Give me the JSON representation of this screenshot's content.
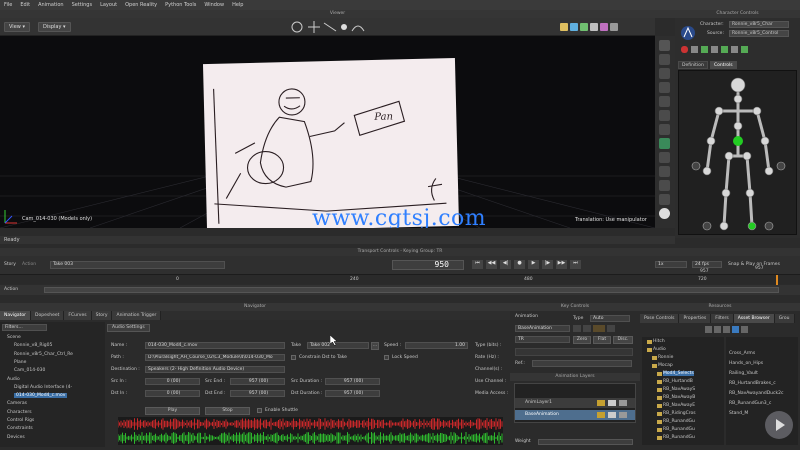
{
  "menu": [
    "File",
    "Edit",
    "Animation",
    "Settings",
    "Layout",
    "Open Reality",
    "Python Tools",
    "Window",
    "Help"
  ],
  "viewer": {
    "title": "Viewer",
    "view_btn": "View",
    "display_btn": "Display",
    "camera_label": "Cam_014-030 (Models only)",
    "translation_label": "Translation: Use manipulator",
    "axis_label": "T (Gbl)",
    "watermark": "www.cgtsj.com",
    "sketch_text": "Pan"
  },
  "status": {
    "ready": "Ready"
  },
  "character_controls": {
    "title": "Character Controls",
    "character_label": "Character:",
    "character_value": "Ronnie_v8r5_Char",
    "source_label": "Source:",
    "source_value": "Ronnie_v8r5_Control",
    "tabs": [
      "Definition",
      "Controls"
    ]
  },
  "transport": {
    "title": "Transport Controls  -  Keying Group: TR",
    "story_label": "Story",
    "action_label": "Action",
    "take_value": "Take 003",
    "frame_value": "950",
    "speed": "1x",
    "fps": "24 fps",
    "snap": "Snap & Play on Frames",
    "end_a": "957",
    "end_b": "957",
    "ruler_ticks": [
      "0",
      "240",
      "480",
      "720"
    ],
    "action_row_label": "Action"
  },
  "navigator": {
    "title": "Navigator",
    "tabs": [
      "Navigator",
      "Dopesheet",
      "FCurves",
      "Story",
      "Animation Trigger"
    ],
    "filters_label": "Filters...",
    "tree": [
      {
        "label": "Scene",
        "indent": 1
      },
      {
        "label": "Ronnie_v8_Rig05",
        "indent": 2
      },
      {
        "label": "Ronnie_v8r5_Char_Ctrl_Re",
        "indent": 2
      },
      {
        "label": "Plane",
        "indent": 2
      },
      {
        "label": "Cam_014-030",
        "indent": 2
      },
      {
        "label": "Audio",
        "indent": 1
      },
      {
        "label": "Digital Audio Interface (4-",
        "indent": 2
      },
      {
        "label": "014-030_Mod4_c.mov",
        "indent": 2,
        "selected": true
      },
      {
        "label": "Cameras",
        "indent": 1
      },
      {
        "label": "Characters",
        "indent": 1
      },
      {
        "label": "Control Rigs",
        "indent": 1
      },
      {
        "label": "Constraints",
        "indent": 1
      },
      {
        "label": "Devices",
        "indent": 1
      }
    ]
  },
  "audio_settings": {
    "tab": "Audio Settings",
    "name_label": "Name :",
    "name_value": "014-030_Mod4_c.mov",
    "take_label": "Take",
    "take_value": "Take 002",
    "speed_label": "Speed :",
    "speed_value": "1.00",
    "type_label": "Type (bits) :",
    "path_label": "Path :",
    "path_value": "D:\\Pluralsight_AH_Course_02\\C3_Module\\4\\014-030_Mo",
    "constrain_label": "Constrain Dst to Take",
    "lock_speed_label": "Lock Speed",
    "rate_label": "Rate (Hz) :",
    "destination_label": "Destination :",
    "destination_value": "Speakers (2- High Definition Audio Device)",
    "channels_label": "Channel(s) :",
    "src_in_label": "Src In :",
    "src_in_value": "0 (00)",
    "src_end_label": "Src End :",
    "src_end_value": "957 (00)",
    "src_dur_label": "Src Duration :",
    "src_dur_value": "957 (00)",
    "use_channel_label": "Use Channel :",
    "dst_in_label": "Dst In :",
    "dst_in_value": "0 (00)",
    "dst_end_label": "Dst End :",
    "dst_end_value": "957 (00)",
    "dst_dur_label": "Dst Duration :",
    "dst_dur_value": "957 (00)",
    "media_label": "Media Access :",
    "play_btn": "Play",
    "stop_btn": "Stop",
    "shuttle_label": "Enable Shuttle"
  },
  "key_controls": {
    "title": "Key Controls",
    "animation_label": "Animation",
    "type_label": "Type",
    "type_value": "Auto",
    "base_value": "BaseAnimation",
    "tr_value": "TR",
    "zero_btn": "Zero",
    "flat_btn": "Flat",
    "disc_btn": "Disc.",
    "ref_label": "Ref.:",
    "layers_title": "Animation Layers",
    "layers": [
      "AnimLayer1",
      "BaseAnimation"
    ],
    "weight_label": "Weight"
  },
  "resources": {
    "title": "Resources",
    "tabs": [
      "Pose Controls",
      "Properties",
      "Filters",
      "Asset Browser",
      "Grou"
    ],
    "folders": [
      "Hitch",
      "Audio",
      "Ronnie",
      "Mocap",
      "Mod4_Selects",
      "RB_HurtandB",
      "RB_NavAwayS",
      "RB_NavAwayB",
      "RB_NavAwayE",
      "RB_RidingCros",
      "RB_RunandGu",
      "RB_RunandGu",
      "RB_RunandGu"
    ],
    "files": [
      "Cross_Arms",
      "Hands_on_Hips",
      "Railing_Vault",
      "RB_HurtandBrakes_c",
      "RB_NavAwayandDuck2c",
      "RB_RunandGun3_c",
      "Stand_M"
    ]
  }
}
